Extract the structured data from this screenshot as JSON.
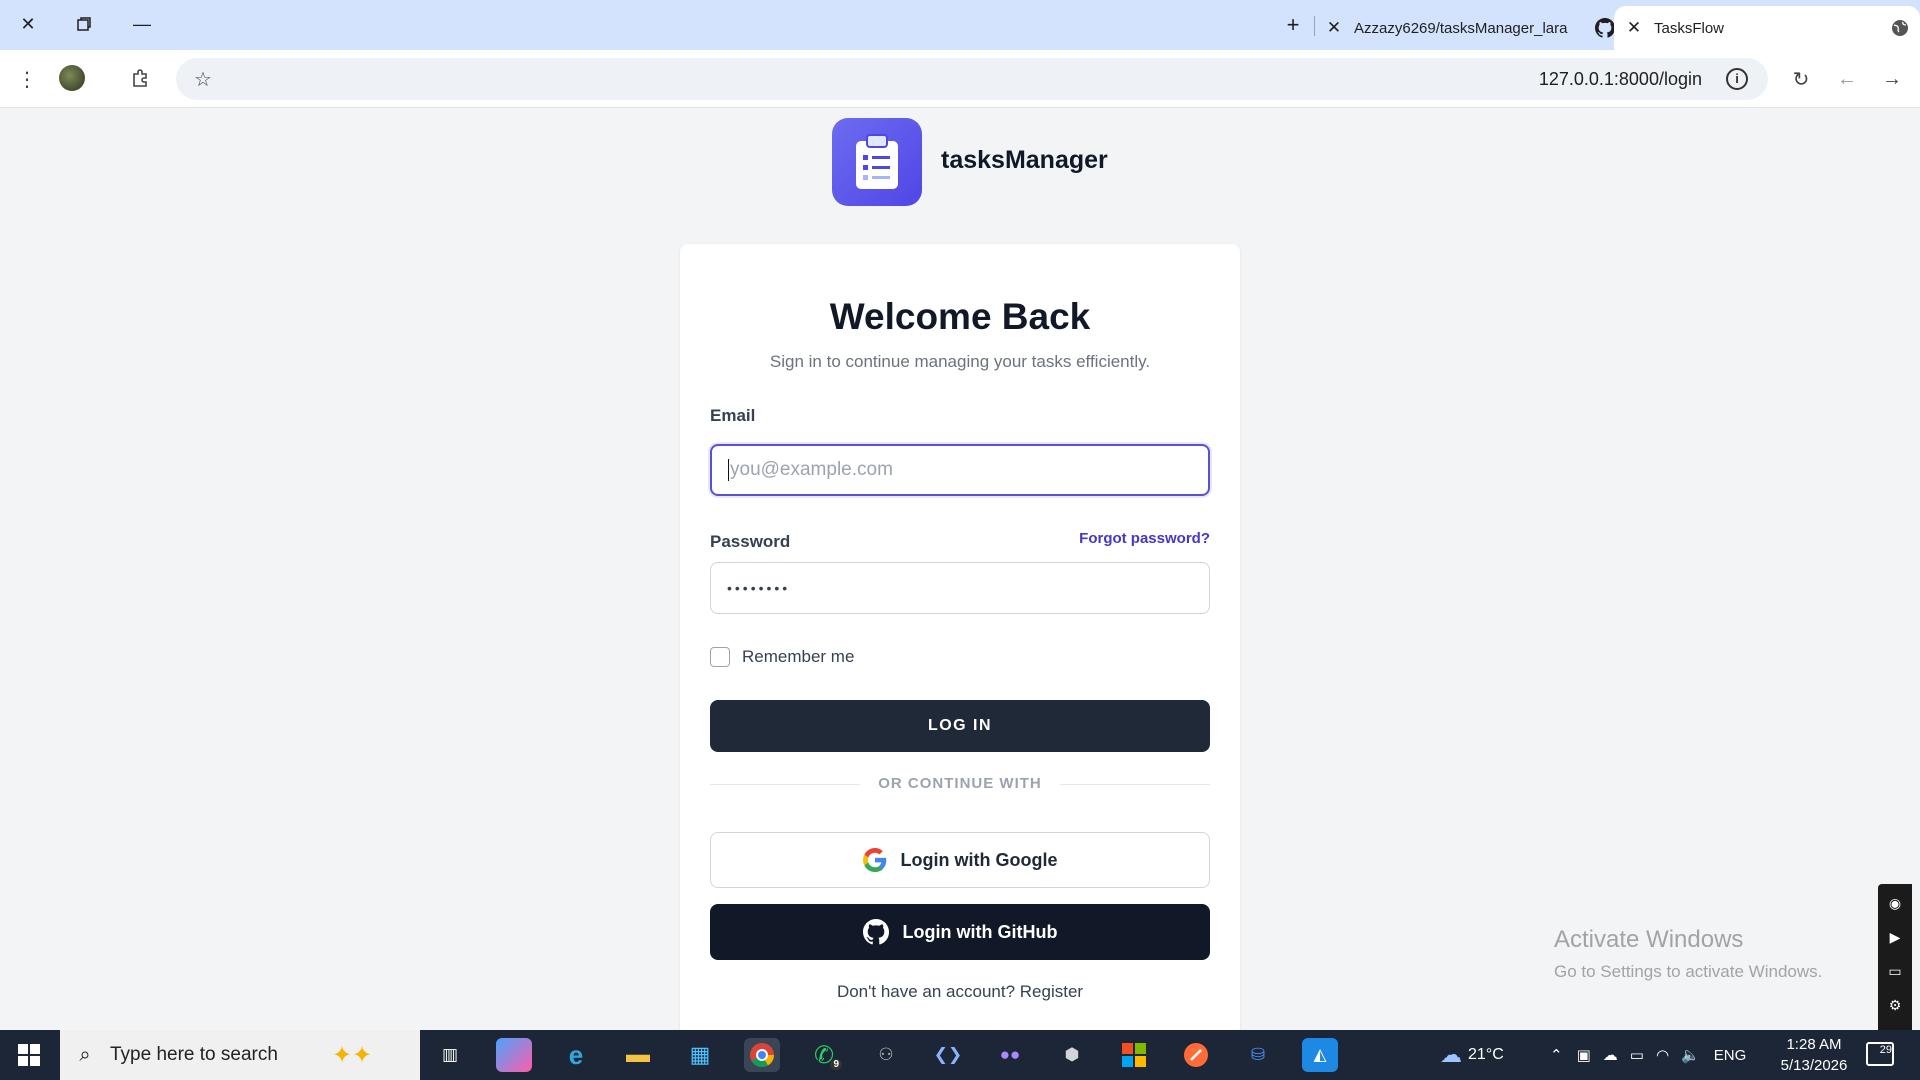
{
  "browser": {
    "tabs": [
      {
        "title": "Azzazy6269/tasksManager_lara",
        "active": false
      },
      {
        "title": "TasksFlow",
        "active": true
      }
    ],
    "url": "127.0.0.1:8000/login"
  },
  "brand": {
    "name": "tasksManager",
    "accent": "#4f46e5"
  },
  "login": {
    "title": "Welcome Back",
    "subtitle": "Sign in to continue managing your tasks efficiently.",
    "email_label": "Email",
    "email_placeholder": "you@example.com",
    "password_label": "Password",
    "forgot_label": "Forgot password?",
    "password_mask": "••••••••",
    "remember_label": "Remember me",
    "remember_checked": false,
    "login_button": "LOG IN",
    "divider": "OR CONTINUE WITH",
    "google_button": "Login with Google",
    "github_button": "Login with GitHub",
    "register_prompt": "Don't have an account? Register"
  },
  "watermark": {
    "line1": "Activate Windows",
    "line2": "Go to Settings to activate Windows."
  },
  "taskbar": {
    "search_placeholder": "Type here to search",
    "whatsapp_badge": "9",
    "weather": "21°C",
    "language": "ENG",
    "time": "1:28 AM",
    "date": "5/13/2026",
    "notifications": "29"
  }
}
